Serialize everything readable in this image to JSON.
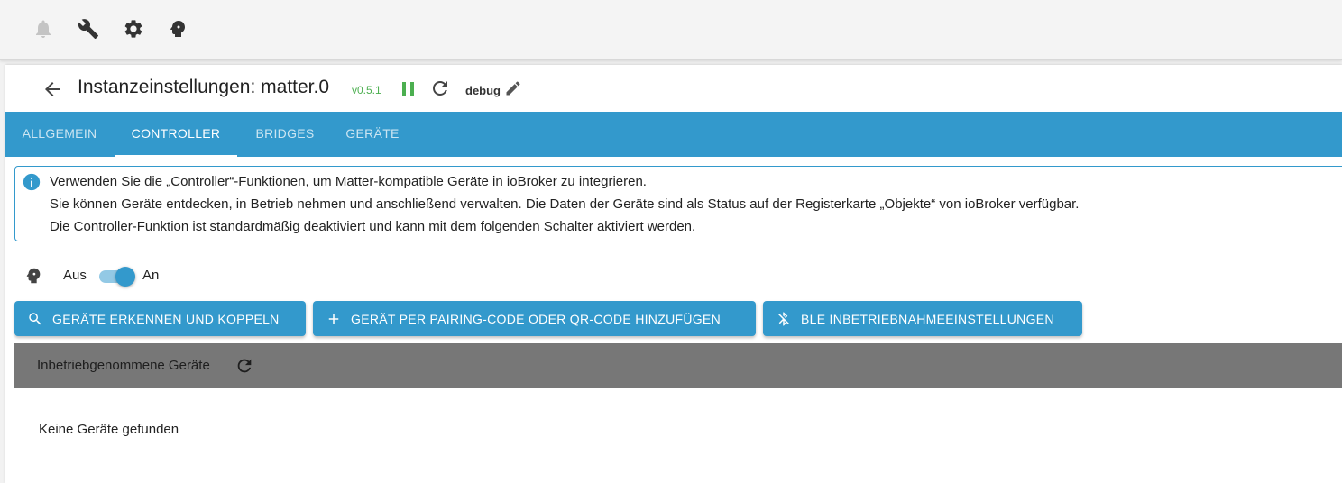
{
  "topbar": {
    "icons": [
      "bell-icon",
      "wrench-icon",
      "gear-icon",
      "head-icon"
    ]
  },
  "header": {
    "title": "Instanzeinstellungen: matter.0",
    "version": "v0.5.1",
    "log_level": "debug"
  },
  "tabs": [
    {
      "label": "ALLGEMEIN",
      "active": false
    },
    {
      "label": "CONTROLLER",
      "active": true
    },
    {
      "label": "BRIDGES",
      "active": false
    },
    {
      "label": "GERÄTE",
      "active": false
    }
  ],
  "info": {
    "lines": [
      "Verwenden Sie die „Controller“-Funktionen, um Matter-kompatible Geräte in ioBroker zu integrieren.",
      "Sie können Geräte entdecken, in Betrieb nehmen und anschließend verwalten. Die Daten der Geräte sind als Status auf der Registerkarte „Objekte“ von ioBroker verfügbar.",
      "Die Controller-Funktion ist standardmäßig deaktiviert und kann mit dem folgenden Schalter aktiviert werden."
    ]
  },
  "controller_toggle": {
    "off_label": "Aus",
    "on_label": "An",
    "enabled": true
  },
  "buttons": {
    "discover": "GERÄTE ERKENNEN UND KOPPELN",
    "add_by_code": "GERÄT PER PAIRING-CODE ODER QR-CODE HINZUFÜGEN",
    "ble_settings": "BLE INBETRIEBNAHMEEINSTELLUNGEN"
  },
  "devices_section": {
    "title": "Inbetriebgenommene Geräte",
    "empty_text": "Keine Geräte gefunden"
  },
  "colors": {
    "primary": "#3399cc",
    "status_green": "#4caf50",
    "section_bg": "#777777"
  }
}
